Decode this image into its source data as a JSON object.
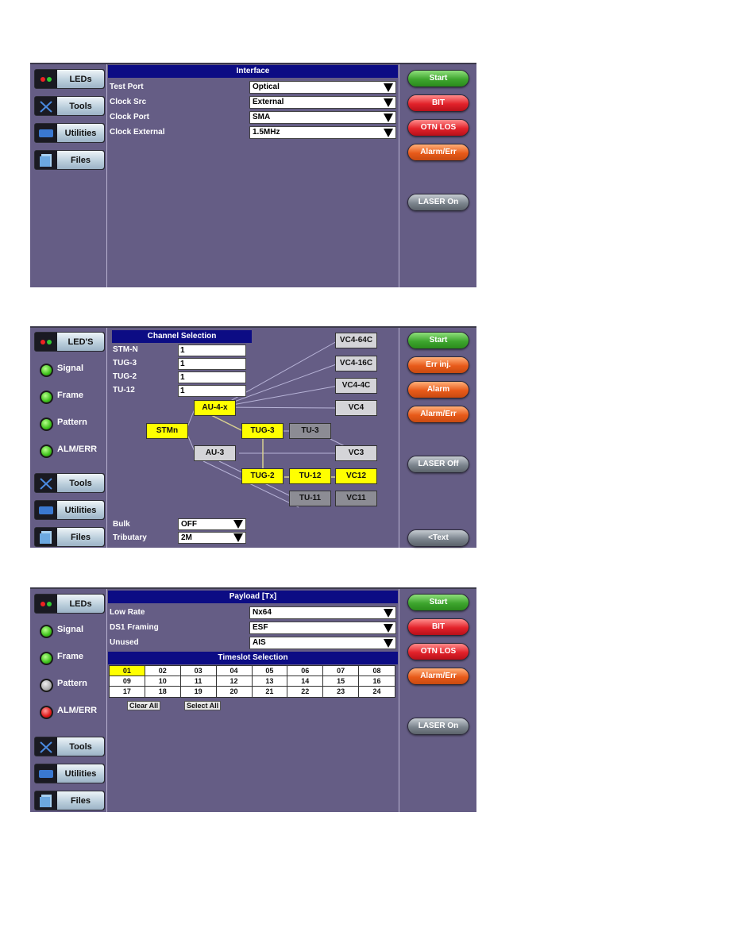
{
  "screen1": {
    "nav": {
      "leds": "LEDs",
      "tools": "Tools",
      "utilities": "Utilities",
      "files": "Files"
    },
    "title": "Interface",
    "fields": [
      {
        "label": "Test Port",
        "value": "Optical"
      },
      {
        "label": "Clock Src",
        "value": "External"
      },
      {
        "label": "Clock Port",
        "value": "SMA"
      },
      {
        "label": "Clock External",
        "value": "1.5MHz"
      }
    ],
    "buttons": {
      "start": "Start",
      "bit": "BIT",
      "otn_los": "OTN LOS",
      "alarm_err": "Alarm/Err",
      "laser": "LASER On"
    }
  },
  "screen2": {
    "nav": {
      "leds": "LED'S",
      "tools": "Tools",
      "utilities": "Utilities",
      "files": "Files"
    },
    "leds": [
      {
        "label": "Signal",
        "state": "green"
      },
      {
        "label": "Frame",
        "state": "green"
      },
      {
        "label": "Pattern",
        "state": "green"
      },
      {
        "label": "ALM/ERR",
        "state": "green"
      }
    ],
    "title": "Channel Selection",
    "fields": [
      {
        "label": "STM-N",
        "value": "1"
      },
      {
        "label": "TUG-3",
        "value": "1"
      },
      {
        "label": "TUG-2",
        "value": "1"
      },
      {
        "label": "TU-12",
        "value": "1"
      }
    ],
    "nodes": {
      "stmn": "STMn",
      "au4x": "AU-4-x",
      "au3": "AU-3",
      "tug3": "TUG-3",
      "tu3": "TU-3",
      "tug2": "TUG-2",
      "tu12": "TU-12",
      "tu11": "TU-11",
      "vc4_64c": "VC4-64C",
      "vc4_16c": "VC4-16C",
      "vc4_4c": "VC4-4C",
      "vc4": "VC4",
      "vc3": "VC3",
      "vc12": "VC12",
      "vc11": "VC11"
    },
    "bulk": {
      "label": "Bulk",
      "value": "OFF"
    },
    "tributary": {
      "label": "Tributary",
      "value": "2M"
    },
    "buttons": {
      "start": "Start",
      "err_inj": "Err inj.",
      "alarm": "Alarm",
      "alarm_err": "Alarm/Err",
      "laser": "LASER Off",
      "text": "<Text"
    }
  },
  "screen3": {
    "nav": {
      "leds": "LEDs",
      "tools": "Tools",
      "utilities": "Utilities",
      "files": "Files"
    },
    "leds": [
      {
        "label": "Signal",
        "state": "green"
      },
      {
        "label": "Frame",
        "state": "green"
      },
      {
        "label": "Pattern",
        "state": "gray"
      },
      {
        "label": "ALM/ERR",
        "state": "red"
      }
    ],
    "title": "Payload [Tx]",
    "fields": [
      {
        "label": "Low Rate",
        "value": "Nx64"
      },
      {
        "label": "DS1 Framing",
        "value": "ESF"
      },
      {
        "label": "Unused",
        "value": "AIS"
      }
    ],
    "timeslot_title": "Timeslot Selection",
    "timeslots": [
      "01",
      "02",
      "03",
      "04",
      "05",
      "06",
      "07",
      "08",
      "09",
      "10",
      "11",
      "12",
      "13",
      "14",
      "15",
      "16",
      "17",
      "18",
      "19",
      "20",
      "21",
      "22",
      "23",
      "24"
    ],
    "selected_timeslots": [
      "01"
    ],
    "clear_all": "Clear All",
    "select_all": "Select All",
    "buttons": {
      "start": "Start",
      "bit": "BIT",
      "otn_los": "OTN LOS",
      "alarm_err": "Alarm/Err",
      "laser": "LASER On"
    }
  },
  "colors": {
    "led_green": "#3fc21c",
    "led_red": "#e01a1a",
    "led_gray": "#b0b0b0",
    "title_bar": "#0c0c84",
    "panel_bg": "#655d85"
  }
}
